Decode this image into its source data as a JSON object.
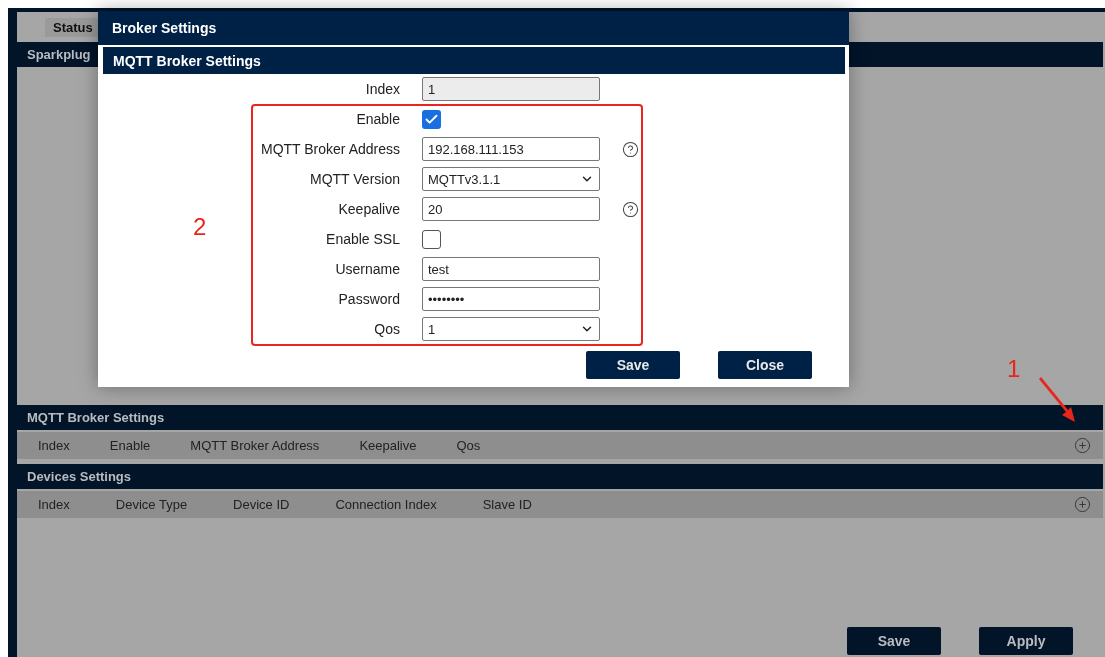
{
  "page": {
    "tabs": [
      {
        "label": "Status",
        "selected": true
      }
    ],
    "section_title": "Sparkplug",
    "sections": [
      {
        "title": "MQTT Broker Settings",
        "columns": [
          "Index",
          "Enable",
          "MQTT Broker Address",
          "Keepalive",
          "Qos"
        ]
      },
      {
        "title": "Devices Settings",
        "columns": [
          "Index",
          "Device Type",
          "Device ID",
          "Connection Index",
          "Slave ID"
        ]
      }
    ],
    "buttons": [
      "Save",
      "Apply"
    ]
  },
  "dialog": {
    "title": "Broker Settings",
    "section_title": "MQTT Broker Settings",
    "fields": [
      {
        "kind": "text",
        "label": "Index",
        "value": "1",
        "disabled": true
      },
      {
        "kind": "checkbox",
        "label": "Enable",
        "checked": true
      },
      {
        "kind": "text",
        "label": "MQTT Broker Address",
        "value": "192.168.111.153",
        "disabled": false,
        "help": true
      },
      {
        "kind": "select",
        "label": "MQTT Version",
        "value": "MQTTv3.1.1"
      },
      {
        "kind": "text",
        "label": "Keepalive",
        "value": "20",
        "disabled": false,
        "help": true
      },
      {
        "kind": "checkbox",
        "label": "Enable SSL",
        "checked": false
      },
      {
        "kind": "text",
        "label": "Username",
        "value": "test",
        "disabled": false
      },
      {
        "kind": "password",
        "label": "Password",
        "value": "••••••••"
      },
      {
        "kind": "select",
        "label": "Qos",
        "value": "1"
      }
    ],
    "buttons": [
      "Save",
      "Close"
    ]
  },
  "annotations": [
    {
      "label": "1"
    },
    {
      "label": "2"
    }
  ]
}
